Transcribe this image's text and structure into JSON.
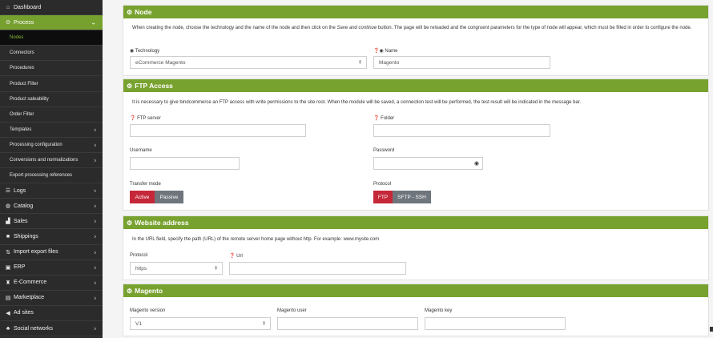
{
  "sidebar": {
    "items": [
      {
        "label": "Dashboard",
        "icon": "home-icon",
        "glyph": "⌂",
        "chevron": "",
        "active": false
      },
      {
        "label": "Process",
        "icon": "gear-icon",
        "glyph": "⚙",
        "chevron": "⌄",
        "active": true
      },
      {
        "label": "Nodes",
        "sub": true,
        "current": true
      },
      {
        "label": "Connectors",
        "sub": true
      },
      {
        "label": "Procedures",
        "sub": true
      },
      {
        "label": "Product Filter",
        "sub": true
      },
      {
        "label": "Product saleability",
        "sub": true
      },
      {
        "label": "Order Filter",
        "sub": true
      },
      {
        "label": "Templates",
        "sub": true,
        "chevron": "›"
      },
      {
        "label": "Processing configuration",
        "sub": true,
        "chevron": "›"
      },
      {
        "label": "Conversions and normalizations",
        "sub": true,
        "chevron": "›"
      },
      {
        "label": "Export processing references",
        "sub": true
      },
      {
        "label": "Logs",
        "icon": "logs-icon",
        "glyph": "☰",
        "chevron": "›"
      },
      {
        "label": "Catalog",
        "icon": "catalog-icon",
        "glyph": "◍",
        "chevron": "›"
      },
      {
        "label": "Sales",
        "icon": "sales-icon",
        "glyph": "▟",
        "chevron": "›"
      },
      {
        "label": "Shippings",
        "icon": "truck-icon",
        "glyph": "■",
        "chevron": "›"
      },
      {
        "label": "Import export files",
        "icon": "import-export-icon",
        "glyph": "⇅",
        "chevron": "›"
      },
      {
        "label": "ERP",
        "icon": "erp-icon",
        "glyph": "▣",
        "chevron": "›"
      },
      {
        "label": "E-Commerce",
        "icon": "basket-icon",
        "glyph": "♜",
        "chevron": "›"
      },
      {
        "label": "Marketplace",
        "icon": "store-icon",
        "glyph": "▤",
        "chevron": "›"
      },
      {
        "label": "Ad sites",
        "icon": "megaphone-icon",
        "glyph": "◀",
        "chevron": ""
      },
      {
        "label": "Social networks",
        "icon": "share-icon",
        "glyph": "♣",
        "chevron": "›"
      }
    ]
  },
  "node": {
    "title": "Node",
    "desc_a": "When creating the node, choose the technology and the name of the node and then click on the ",
    "desc_em": "Save and continue",
    "desc_b": " button. The page will be reloaded and the congruent parameters for the type of node will appear, which must be filled in order to configure the node.",
    "technology_label": "Technology",
    "technology_value": "eCommerce Magento",
    "name_label": "Name",
    "name_value": "Magento"
  },
  "ftp": {
    "title": "FTP Access",
    "desc": "It is necessary to give bindcommerce an FTP access with write permissions to the site root. When the module will be saved, a connection test will be performed, the test result will be indicated in the message bar.",
    "server_label": "FTP server",
    "folder_label": "Folder",
    "username_label": "Username",
    "password_label": "Password",
    "transfer_label": "Transfer mode",
    "transfer_active": "Active",
    "transfer_passive": "Passive",
    "protocol_label": "Protocol",
    "protocol_ftp": "FTP",
    "protocol_sftp": "SFTP - SSH"
  },
  "website": {
    "title": "Website address",
    "desc": "In the URL field, specify the path (URL) of the remote server home page without http. For example: www.mysite.com",
    "protocol_label": "Protocol",
    "protocol_value": "https",
    "url_label": "Url"
  },
  "magento": {
    "title": "Magento",
    "version_label": "Magento version",
    "version_value": "V1",
    "user_label": "Magento user",
    "key_label": "Magento key"
  },
  "icons": {
    "info": "❓",
    "eye": "👁",
    "select_arrow": "⇕"
  },
  "colors": {
    "accent": "#78a22f",
    "danger": "#c52839",
    "secondary": "#6f757c",
    "sidebar": "#2b2b2b"
  }
}
